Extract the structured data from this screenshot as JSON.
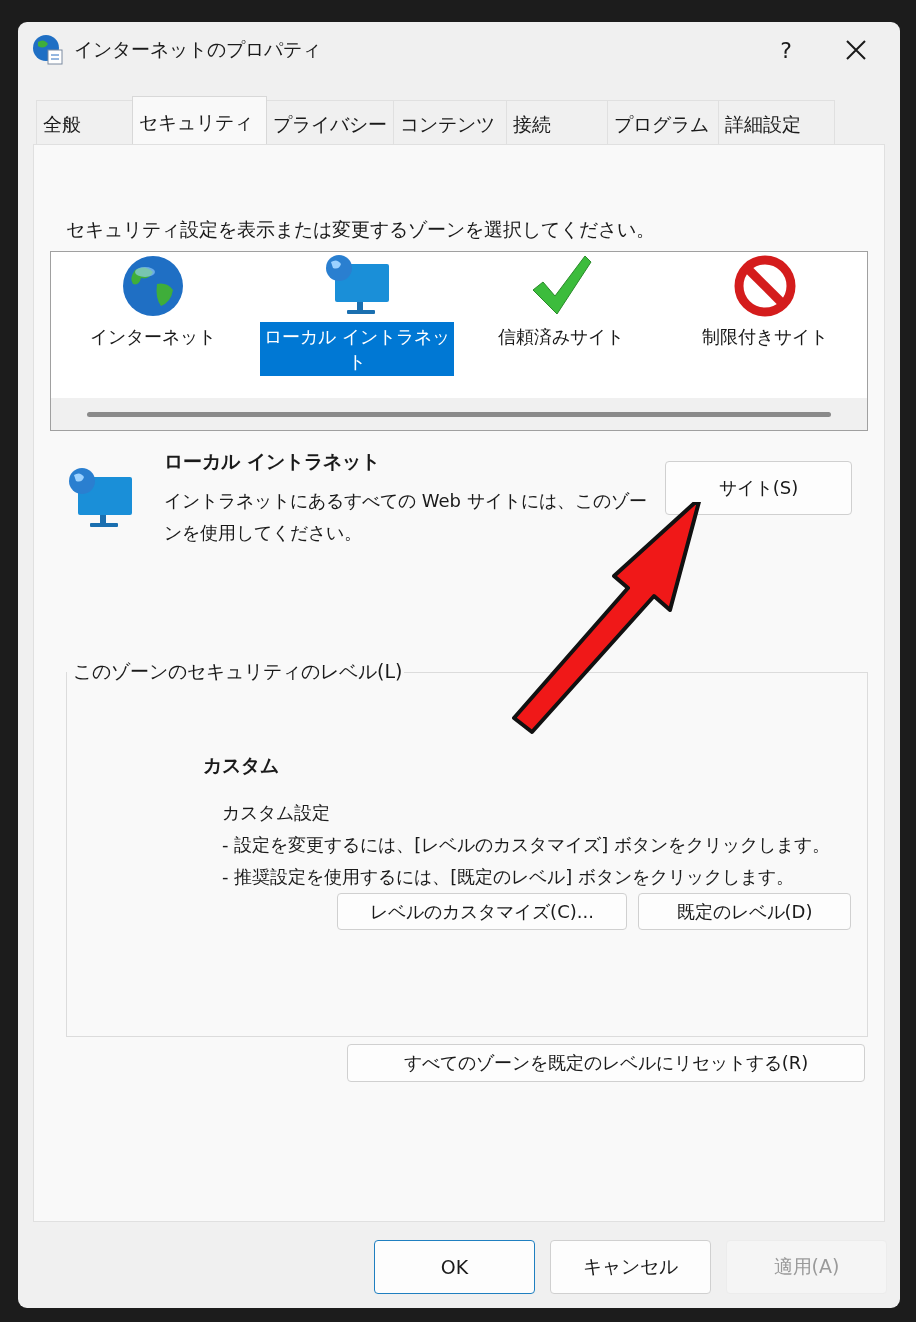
{
  "window": {
    "title": "インターネットのプロパティ",
    "help": "?"
  },
  "tabs": [
    {
      "label": "全般",
      "selected": false
    },
    {
      "label": "セキュリティ",
      "selected": true
    },
    {
      "label": "プライバシー",
      "selected": false
    },
    {
      "label": "コンテンツ",
      "selected": false
    },
    {
      "label": "接続",
      "selected": false
    },
    {
      "label": "プログラム",
      "selected": false
    },
    {
      "label": "詳細設定",
      "selected": false
    }
  ],
  "instruction": "セキュリティ設定を表示または変更するゾーンを選択してください。",
  "zones": [
    {
      "label": "インターネット",
      "kind": "globe",
      "selected": false
    },
    {
      "label": "ローカル イントラネット",
      "kind": "monitor",
      "selected": true
    },
    {
      "label": "信頼済みサイト",
      "kind": "check",
      "selected": false
    },
    {
      "label": "制限付きサイト",
      "kind": "blocked",
      "selected": false
    }
  ],
  "zone_info": {
    "title": "ローカル イントラネット",
    "description": "イントラネットにあるすべての Web サイトには、このゾーンを使用してください。",
    "sites_button": "サイト(S)"
  },
  "security_level": {
    "legend": "このゾーンのセキュリティのレベル(L)",
    "level_name": "カスタム",
    "description_lines": [
      "カスタム設定",
      "- 設定を変更するには、[レベルのカスタマイズ] ボタンをクリックします。",
      "- 推奨設定を使用するには、[既定のレベル] ボタンをクリックします。"
    ],
    "customize_button": "レベルのカスタマイズ(C)...",
    "default_button": "既定のレベル(D)"
  },
  "reset_button": "すべてのゾーンを既定のレベルにリセットする(R)",
  "dialog_buttons": [
    {
      "label": "OK",
      "kind": "default",
      "disabled": false
    },
    {
      "label": "キャンセル",
      "kind": "normal",
      "disabled": false
    },
    {
      "label": "適用(A)",
      "kind": "normal",
      "disabled": true
    }
  ]
}
